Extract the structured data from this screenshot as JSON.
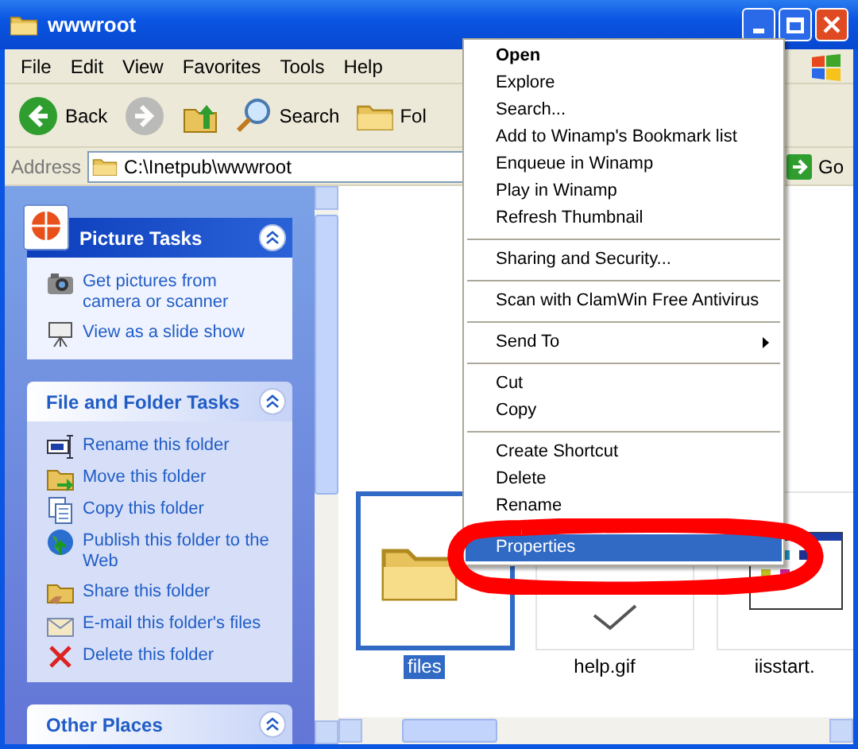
{
  "window": {
    "title": "wwwroot"
  },
  "menu_bar": [
    "File",
    "Edit",
    "View",
    "Favorites",
    "Tools",
    "Help"
  ],
  "toolbar": [
    {
      "kind": "back",
      "label": "Back",
      "disabled": false
    },
    {
      "kind": "forward",
      "disabled": true
    },
    {
      "kind": "up",
      "disabled": false
    },
    {
      "kind": "search",
      "label": "Search",
      "disabled": false
    },
    {
      "kind": "folders",
      "label": "Fol",
      "disabled": false
    }
  ],
  "address_bar": {
    "label": "Address",
    "value": "C:\\Inetpub\\wwwroot",
    "go": "Go"
  },
  "task_panels": [
    {
      "kind": "special",
      "title": "Picture Tasks",
      "items": [
        {
          "label": "Get pictures from camera or scanner"
        },
        {
          "label": "View as a slide show"
        }
      ]
    },
    {
      "kind": "normal",
      "title": "File and Folder Tasks",
      "items": [
        {
          "label": "Rename this folder"
        },
        {
          "label": "Move this folder"
        },
        {
          "label": "Copy this folder"
        },
        {
          "label": "Publish this folder to the Web"
        },
        {
          "label": "Share this folder"
        },
        {
          "label": "E-mail this folder's files"
        },
        {
          "label": "Delete this folder"
        }
      ]
    },
    {
      "kind": "normal",
      "title": "Other Places"
    }
  ],
  "files": [
    {
      "kind": "folder",
      "name": "files",
      "selected": true
    },
    {
      "kind": "image",
      "name": "help.gif",
      "selected": false
    },
    {
      "kind": "page",
      "name": "iisstart.",
      "selected": false
    }
  ],
  "context_menu": [
    {
      "kind": "item",
      "label": "Open",
      "default": true,
      "selected": false,
      "submenu": false
    },
    {
      "kind": "item",
      "label": "Explore",
      "default": false,
      "selected": false,
      "submenu": false
    },
    {
      "kind": "item",
      "label": "Search...",
      "default": false,
      "selected": false,
      "submenu": false
    },
    {
      "kind": "item",
      "label": "Add to Winamp's Bookmark list",
      "default": false,
      "selected": false,
      "submenu": false
    },
    {
      "kind": "item",
      "label": "Enqueue in Winamp",
      "default": false,
      "selected": false,
      "submenu": false
    },
    {
      "kind": "item",
      "label": "Play in Winamp",
      "default": false,
      "selected": false,
      "submenu": false
    },
    {
      "kind": "item",
      "label": "Refresh Thumbnail",
      "default": false,
      "selected": false,
      "submenu": false
    },
    {
      "kind": "separator"
    },
    {
      "kind": "item",
      "label": "Sharing and Security...",
      "default": false,
      "selected": false,
      "submenu": false
    },
    {
      "kind": "separator"
    },
    {
      "kind": "item",
      "label": "Scan with ClamWin Free Antivirus",
      "default": false,
      "selected": false,
      "submenu": false
    },
    {
      "kind": "separator"
    },
    {
      "kind": "item",
      "label": "Send To",
      "default": false,
      "selected": false,
      "submenu": true
    },
    {
      "kind": "separator"
    },
    {
      "kind": "item",
      "label": "Cut",
      "default": false,
      "selected": false,
      "submenu": false
    },
    {
      "kind": "item",
      "label": "Copy",
      "default": false,
      "selected": false,
      "submenu": false
    },
    {
      "kind": "separator"
    },
    {
      "kind": "item",
      "label": "Create Shortcut",
      "default": false,
      "selected": false,
      "submenu": false
    },
    {
      "kind": "item",
      "label": "Delete",
      "default": false,
      "selected": false,
      "submenu": false
    },
    {
      "kind": "item",
      "label": "Rename",
      "default": false,
      "selected": false,
      "submenu": false
    },
    {
      "kind": "separator"
    },
    {
      "kind": "item",
      "label": "Properties",
      "default": false,
      "selected": true,
      "submenu": false
    }
  ]
}
